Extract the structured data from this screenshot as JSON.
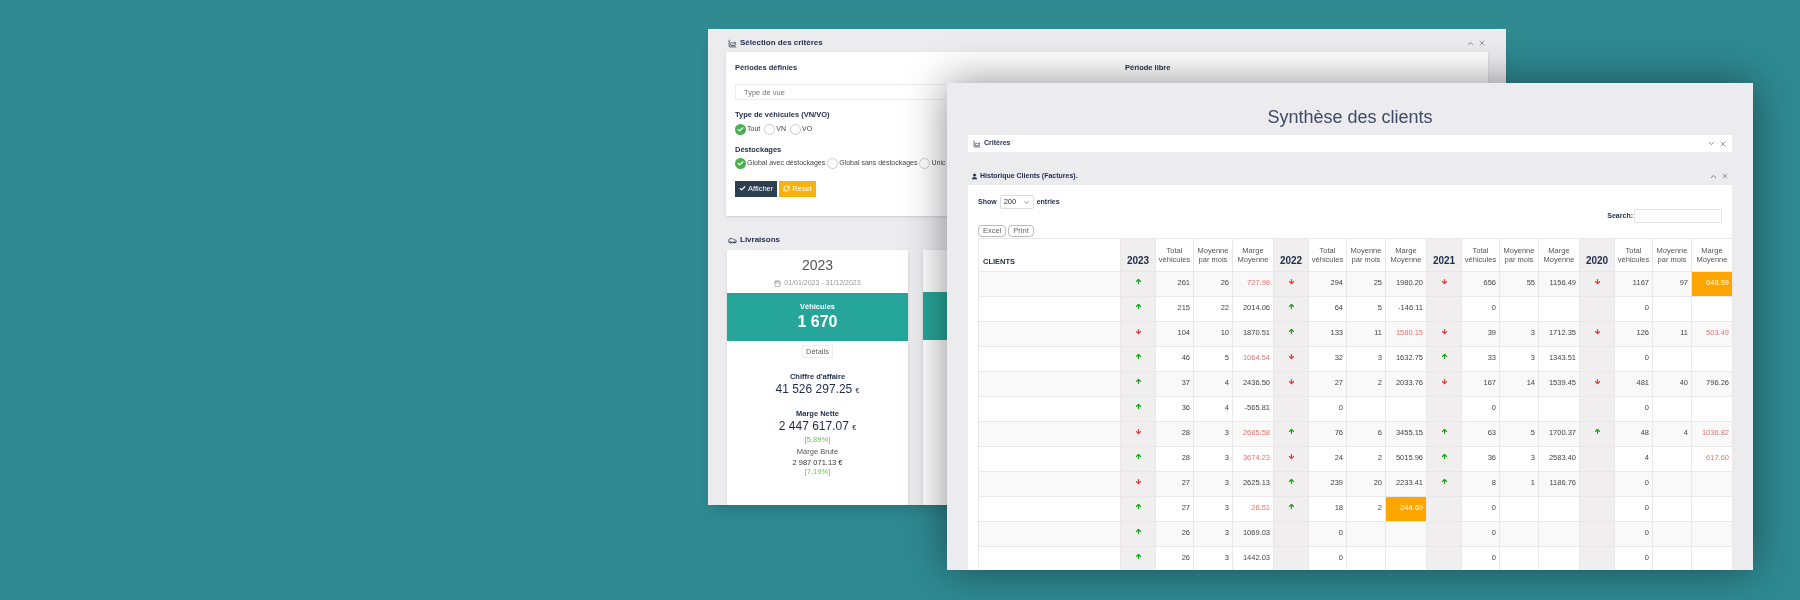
{
  "criteria_window": {
    "title": "Sélection des critères",
    "expanded": true,
    "periods_label": "Périodes définies",
    "free_period_label": "Période libre",
    "view_select": {
      "placeholder": "Type de vue"
    },
    "vehicle_type": {
      "label": "Type de véhicules (VN/VO)",
      "options": [
        {
          "label": "Tout",
          "selected": true
        },
        {
          "label": "VN",
          "selected": false
        },
        {
          "label": "VO",
          "selected": false
        }
      ]
    },
    "destocking": {
      "label": "Déstockages",
      "options": [
        {
          "label": "Global avec déstockages",
          "selected": true
        },
        {
          "label": "Global sans déstockages",
          "selected": false
        },
        {
          "label": "Unic",
          "selected": false
        }
      ]
    },
    "buttons": [
      {
        "kind": "primary",
        "label": "Afficher"
      },
      {
        "kind": "warning",
        "label": "Reset"
      }
    ],
    "deliveries": {
      "title": "Livraisons",
      "cards": [
        {
          "year": "2023",
          "date_range": "01/01/2023 - 31/12/2023",
          "vehicles_label": "Véhicules",
          "vehicles": "1 670",
          "details_button": "Détails",
          "revenue_label": "Chiffre d'affaire",
          "revenue": "41 526 297.25",
          "net_margin_label": "Marge Nette",
          "net_margin": "2 447 617.07",
          "net_margin_pct": "[5,89%]",
          "gross_margin_label": "Marge Brute",
          "gross_margin": "2 987 071.13 €",
          "gross_margin_pct": "[7,19%]",
          "currency": "€"
        }
      ]
    }
  },
  "clients_window": {
    "title": "Synthèse des clients",
    "criteria_panel": {
      "title": "Critères",
      "expanded": false
    },
    "history_panel": {
      "title": "Historique Clients (Factures).",
      "expanded": true,
      "show_label": "Show",
      "page_size": "200",
      "entries_label": "entries",
      "search_label": "Search:",
      "export_buttons": [
        "Excel",
        "Print"
      ],
      "table": {
        "client_header": "CLIENTS",
        "years": [
          {
            "year": "2023",
            "columns": [
              "Total véhicules",
              "Moyenne par mois",
              "Marge Moyenne"
            ]
          },
          {
            "year": "2022",
            "columns": [
              "Total véhicules",
              "Moyenne par mois",
              "Marge Moyenne"
            ]
          },
          {
            "year": "2021",
            "columns": [
              "Total véhicules",
              "Moyenne par mois",
              "Marge Moyenne"
            ]
          },
          {
            "year": "2020",
            "columns": [
              "Total véhicules",
              "Moyenne par mois",
              "Marge Moyenne"
            ]
          }
        ],
        "rows": [
          {
            "years": [
              {
                "kind": "up",
                "total": "261",
                "per_month": "26",
                "margin": {
                  "value": "727.98",
                  "flagged": true,
                  "highlighted": false
                }
              },
              {
                "kind": "down",
                "total": "294",
                "per_month": "25",
                "margin": {
                  "value": "1980.20",
                  "flagged": false,
                  "highlighted": false
                }
              },
              {
                "kind": "down",
                "total": "656",
                "per_month": "55",
                "margin": {
                  "value": "1156.49",
                  "flagged": false,
                  "highlighted": false
                }
              },
              {
                "kind": "down",
                "total": "1167",
                "per_month": "97",
                "margin": {
                  "value": "648.59",
                  "flagged": false,
                  "highlighted": true
                }
              }
            ]
          },
          {
            "years": [
              {
                "kind": "up",
                "total": "215",
                "per_month": "22",
                "margin": {
                  "value": "2014.06",
                  "flagged": false,
                  "highlighted": false
                }
              },
              {
                "kind": "up",
                "total": "64",
                "per_month": "5",
                "margin": {
                  "value": "-146.11",
                  "flagged": false,
                  "highlighted": false
                }
              },
              {
                "kind": "none",
                "total": "0"
              },
              {
                "kind": "none",
                "total": "0"
              }
            ]
          },
          {
            "years": [
              {
                "kind": "down",
                "total": "104",
                "per_month": "10",
                "margin": {
                  "value": "1870.51",
                  "flagged": false,
                  "highlighted": false
                }
              },
              {
                "kind": "up",
                "total": "133",
                "per_month": "11",
                "margin": {
                  "value": "1580.15",
                  "flagged": true,
                  "highlighted": false
                }
              },
              {
                "kind": "down",
                "total": "39",
                "per_month": "3",
                "margin": {
                  "value": "1712.35",
                  "flagged": false,
                  "highlighted": false
                }
              },
              {
                "kind": "down",
                "total": "126",
                "per_month": "11",
                "margin": {
                  "value": "503.49",
                  "flagged": true,
                  "highlighted": false
                }
              }
            ]
          },
          {
            "years": [
              {
                "kind": "up",
                "total": "46",
                "per_month": "5",
                "margin": {
                  "value": "1064.54",
                  "flagged": true,
                  "highlighted": false
                }
              },
              {
                "kind": "down",
                "total": "32",
                "per_month": "3",
                "margin": {
                  "value": "1632.75",
                  "flagged": false,
                  "highlighted": false
                }
              },
              {
                "kind": "up",
                "total": "33",
                "per_month": "3",
                "margin": {
                  "value": "1343.51",
                  "flagged": false,
                  "highlighted": false
                }
              },
              {
                "kind": "none",
                "total": "0"
              }
            ]
          },
          {
            "years": [
              {
                "kind": "up",
                "total": "37",
                "per_month": "4",
                "margin": {
                  "value": "2436.50",
                  "flagged": false,
                  "highlighted": false
                }
              },
              {
                "kind": "down",
                "total": "27",
                "per_month": "2",
                "margin": {
                  "value": "2033.76",
                  "flagged": false,
                  "highlighted": false
                }
              },
              {
                "kind": "down",
                "total": "167",
                "per_month": "14",
                "margin": {
                  "value": "1539.45",
                  "flagged": false,
                  "highlighted": false
                }
              },
              {
                "kind": "down",
                "total": "481",
                "per_month": "40",
                "margin": {
                  "value": "796.26",
                  "flagged": false,
                  "highlighted": false
                }
              }
            ]
          },
          {
            "years": [
              {
                "kind": "up",
                "total": "36",
                "per_month": "4",
                "margin": {
                  "value": "-565.81",
                  "flagged": false,
                  "highlighted": false
                }
              },
              {
                "kind": "none",
                "total": "0"
              },
              {
                "kind": "none",
                "total": "0"
              },
              {
                "kind": "none",
                "total": "0"
              }
            ]
          },
          {
            "years": [
              {
                "kind": "down",
                "total": "28",
                "per_month": "3",
                "margin": {
                  "value": "2685.58",
                  "flagged": true,
                  "highlighted": false
                }
              },
              {
                "kind": "up",
                "total": "76",
                "per_month": "6",
                "margin": {
                  "value": "3455.15",
                  "flagged": false,
                  "highlighted": false
                }
              },
              {
                "kind": "up",
                "total": "63",
                "per_month": "5",
                "margin": {
                  "value": "1700.37",
                  "flagged": false,
                  "highlighted": false
                }
              },
              {
                "kind": "up",
                "total": "48",
                "per_month": "4",
                "margin": {
                  "value": "1036.82",
                  "flagged": true,
                  "highlighted": false
                }
              }
            ]
          },
          {
            "years": [
              {
                "kind": "up",
                "total": "28",
                "per_month": "3",
                "margin": {
                  "value": "3674.23",
                  "flagged": true,
                  "highlighted": false
                }
              },
              {
                "kind": "down",
                "total": "24",
                "per_month": "2",
                "margin": {
                  "value": "5015.96",
                  "flagged": false,
                  "highlighted": false
                }
              },
              {
                "kind": "up",
                "total": "36",
                "per_month": "3",
                "margin": {
                  "value": "2583.40",
                  "flagged": false,
                  "highlighted": false
                }
              },
              {
                "kind": "none",
                "total": "4",
                "margin": {
                  "value": "617.60",
                  "flagged": true,
                  "highlighted": false
                }
              }
            ]
          },
          {
            "years": [
              {
                "kind": "down",
                "total": "27",
                "per_month": "3",
                "margin": {
                  "value": "2625.13",
                  "flagged": false,
                  "highlighted": false
                }
              },
              {
                "kind": "up",
                "total": "239",
                "per_month": "20",
                "margin": {
                  "value": "2233.41",
                  "flagged": false,
                  "highlighted": false
                }
              },
              {
                "kind": "up",
                "total": "8",
                "per_month": "1",
                "margin": {
                  "value": "1186.76",
                  "flagged": false,
                  "highlighted": false
                }
              },
              {
                "kind": "none",
                "total": "0"
              }
            ]
          },
          {
            "years": [
              {
                "kind": "up",
                "total": "27",
                "per_month": "3",
                "margin": {
                  "value": "26.51",
                  "flagged": true,
                  "highlighted": false
                }
              },
              {
                "kind": "up",
                "total": "18",
                "per_month": "2",
                "margin": {
                  "value": "244.69",
                  "flagged": false,
                  "highlighted": true
                }
              },
              {
                "kind": "none",
                "total": "0"
              },
              {
                "kind": "none",
                "total": "0"
              }
            ]
          },
          {
            "years": [
              {
                "kind": "up",
                "total": "26",
                "per_month": "3",
                "margin": {
                  "value": "1069.03",
                  "flagged": false,
                  "highlighted": false
                }
              },
              {
                "kind": "none",
                "total": "0"
              },
              {
                "kind": "none",
                "total": "0"
              },
              {
                "kind": "none",
                "total": "0"
              }
            ]
          },
          {
            "years": [
              {
                "kind": "up",
                "total": "26",
                "per_month": "3",
                "margin": {
                  "value": "1442.03",
                  "flagged": false,
                  "highlighted": false
                }
              },
              {
                "kind": "none",
                "total": "0"
              },
              {
                "kind": "none",
                "total": "0"
              },
              {
                "kind": "none",
                "total": "0"
              }
            ]
          }
        ]
      }
    }
  }
}
